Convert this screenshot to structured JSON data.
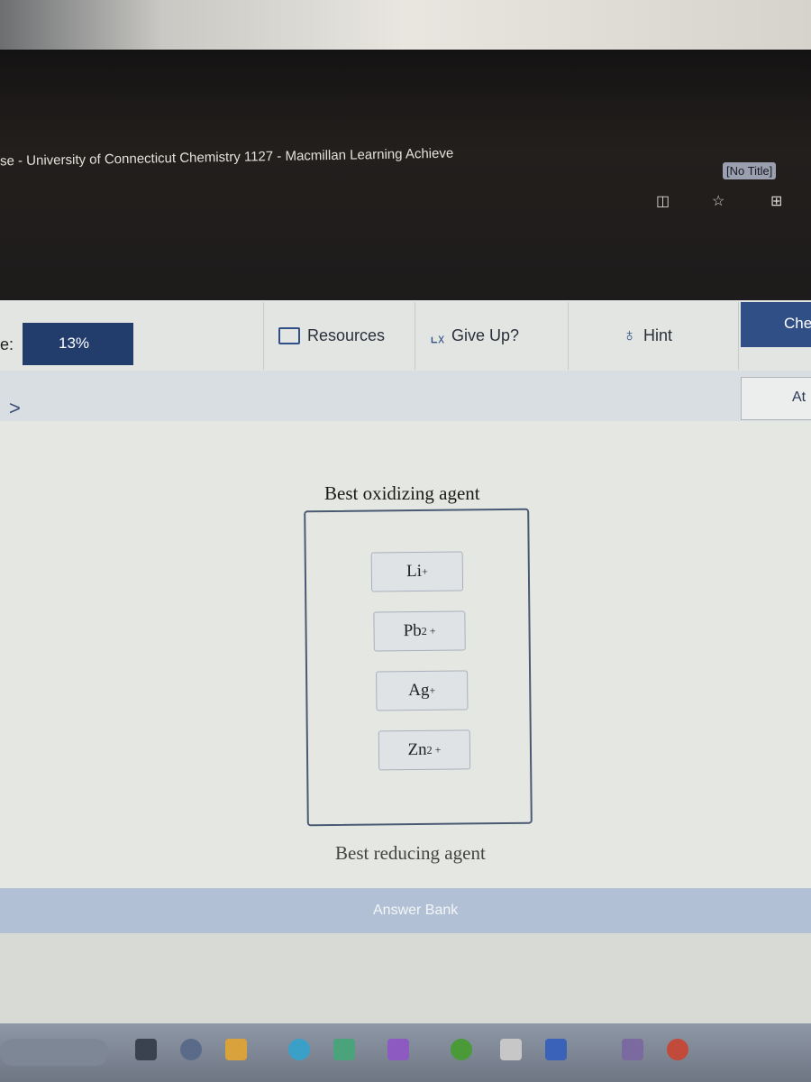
{
  "browser": {
    "tab_title": "se - University of Connecticut Chemistry 1127 - Macmillan Learning Achieve",
    "extension_label": "[No Title]",
    "icons": [
      "split-screen-icon",
      "favorites-icon",
      "collections-icon"
    ]
  },
  "toolbar": {
    "score_label": "e:",
    "progress": "13%",
    "resources": "Resources",
    "give_up": "Give Up?",
    "hint": "Hint",
    "check": "Che",
    "attempt": "At"
  },
  "question": {
    "top_label": "Best oxidizing agent",
    "bottom_label": "Best reducing agent",
    "items": [
      {
        "base": "Li",
        "charge": "+"
      },
      {
        "base": "Pb",
        "charge": "2 +"
      },
      {
        "base": "Ag",
        "charge": "+"
      },
      {
        "base": "Zn",
        "charge": "2 +"
      }
    ]
  },
  "answer_bank": {
    "label": "Answer Bank"
  },
  "colors": {
    "primary": "#223c6c",
    "answer_bank": "#b1c0d4"
  }
}
